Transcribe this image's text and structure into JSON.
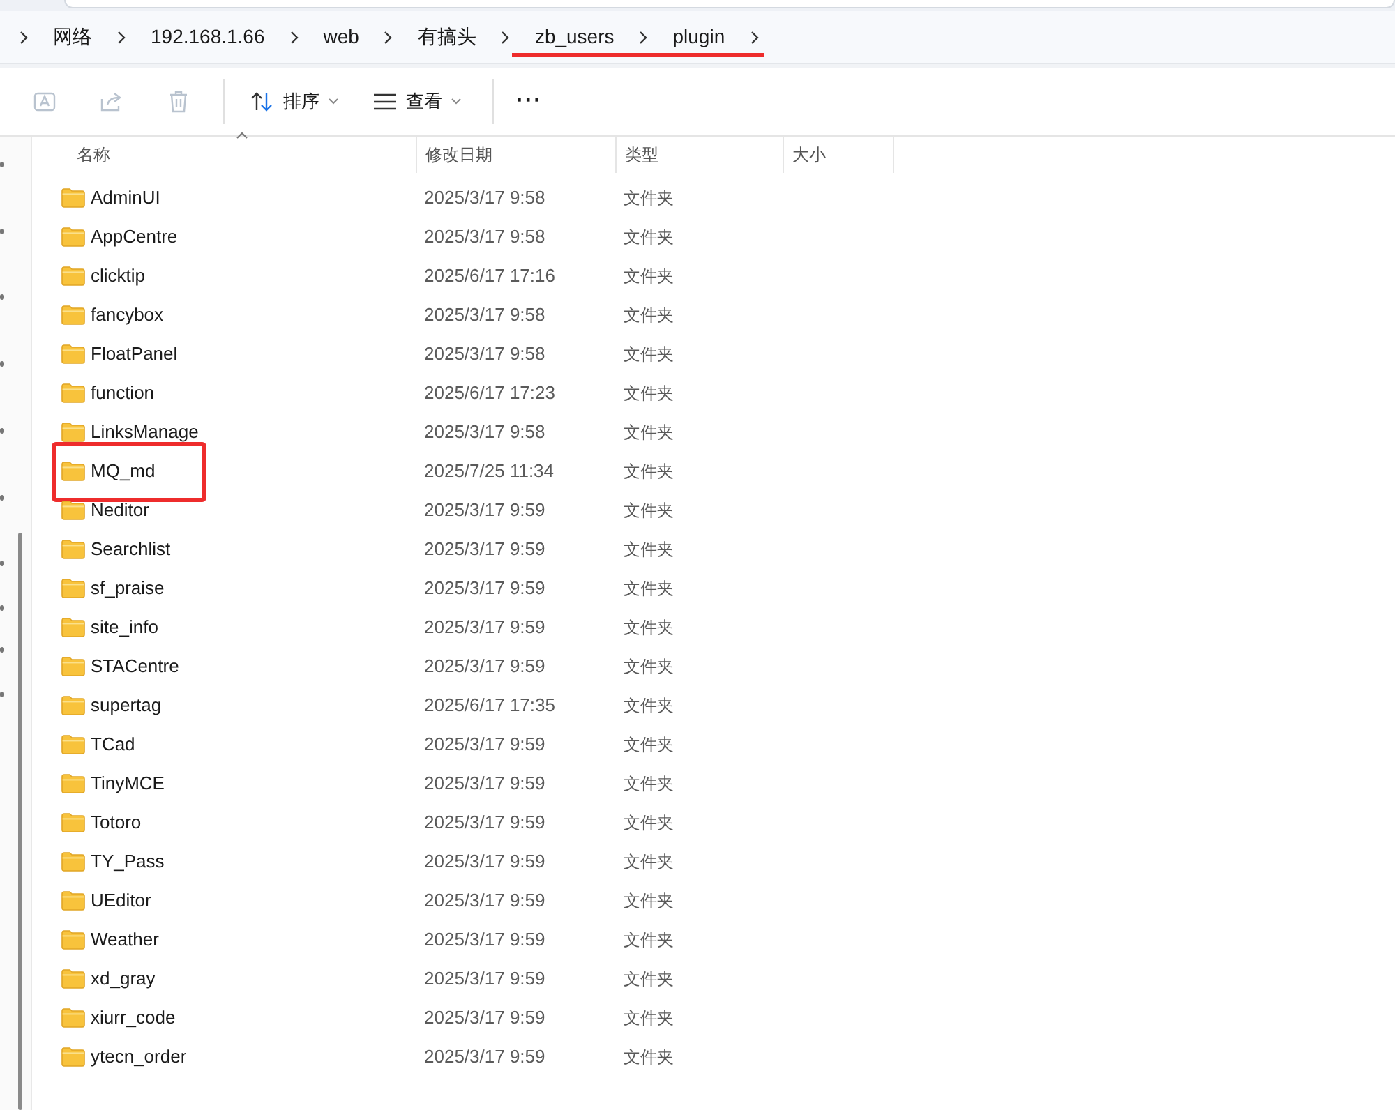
{
  "breadcrumb": [
    {
      "label": "网络",
      "marked": false
    },
    {
      "label": "192.168.1.66",
      "marked": false
    },
    {
      "label": "web",
      "marked": false
    },
    {
      "label": "有搞头",
      "marked": false
    },
    {
      "label": "zb_users",
      "marked": true
    },
    {
      "label": "plugin",
      "marked": true
    }
  ],
  "toolbar": {
    "buttons": [
      {
        "kind": "rename",
        "disabled": true
      },
      {
        "kind": "share",
        "disabled": true
      },
      {
        "kind": "delete",
        "disabled": true
      }
    ],
    "sort": "排序",
    "view": "查看",
    "more": "···"
  },
  "table": {
    "columns": [
      "名称",
      "修改日期",
      "类型",
      "大小"
    ],
    "rows": [
      {
        "name": "AdminUI",
        "modified": "2025/3/17 9:58",
        "type": "文件夹",
        "marked": false
      },
      {
        "name": "AppCentre",
        "modified": "2025/3/17 9:58",
        "type": "文件夹",
        "marked": false
      },
      {
        "name": "clicktip",
        "modified": "2025/6/17 17:16",
        "type": "文件夹",
        "marked": false
      },
      {
        "name": "fancybox",
        "modified": "2025/3/17 9:58",
        "type": "文件夹",
        "marked": false
      },
      {
        "name": "FloatPanel",
        "modified": "2025/3/17 9:58",
        "type": "文件夹",
        "marked": false
      },
      {
        "name": "function",
        "modified": "2025/6/17 17:23",
        "type": "文件夹",
        "marked": false
      },
      {
        "name": "LinksManage",
        "modified": "2025/3/17 9:58",
        "type": "文件夹",
        "marked": false
      },
      {
        "name": "MQ_md",
        "modified": "2025/7/25 11:34",
        "type": "文件夹",
        "marked": true
      },
      {
        "name": "Neditor",
        "modified": "2025/3/17 9:59",
        "type": "文件夹",
        "marked": false
      },
      {
        "name": "Searchlist",
        "modified": "2025/3/17 9:59",
        "type": "文件夹",
        "marked": false
      },
      {
        "name": "sf_praise",
        "modified": "2025/3/17 9:59",
        "type": "文件夹",
        "marked": false
      },
      {
        "name": "site_info",
        "modified": "2025/3/17 9:59",
        "type": "文件夹",
        "marked": false
      },
      {
        "name": "STACentre",
        "modified": "2025/3/17 9:59",
        "type": "文件夹",
        "marked": false
      },
      {
        "name": "supertag",
        "modified": "2025/6/17 17:35",
        "type": "文件夹",
        "marked": false
      },
      {
        "name": "TCad",
        "modified": "2025/3/17 9:59",
        "type": "文件夹",
        "marked": false
      },
      {
        "name": "TinyMCE",
        "modified": "2025/3/17 9:59",
        "type": "文件夹",
        "marked": false
      },
      {
        "name": "Totoro",
        "modified": "2025/3/17 9:59",
        "type": "文件夹",
        "marked": false
      },
      {
        "name": "TY_Pass",
        "modified": "2025/3/17 9:59",
        "type": "文件夹",
        "marked": false
      },
      {
        "name": "UEditor",
        "modified": "2025/3/17 9:59",
        "type": "文件夹",
        "marked": false
      },
      {
        "name": "Weather",
        "modified": "2025/3/17 9:59",
        "type": "文件夹",
        "marked": false
      },
      {
        "name": "xd_gray",
        "modified": "2025/3/17 9:59",
        "type": "文件夹",
        "marked": false
      },
      {
        "name": "xiurr_code",
        "modified": "2025/3/17 9:59",
        "type": "文件夹",
        "marked": false
      },
      {
        "name": "ytecn_order",
        "modified": "2025/3/17 9:59",
        "type": "文件夹",
        "marked": false
      }
    ]
  }
}
